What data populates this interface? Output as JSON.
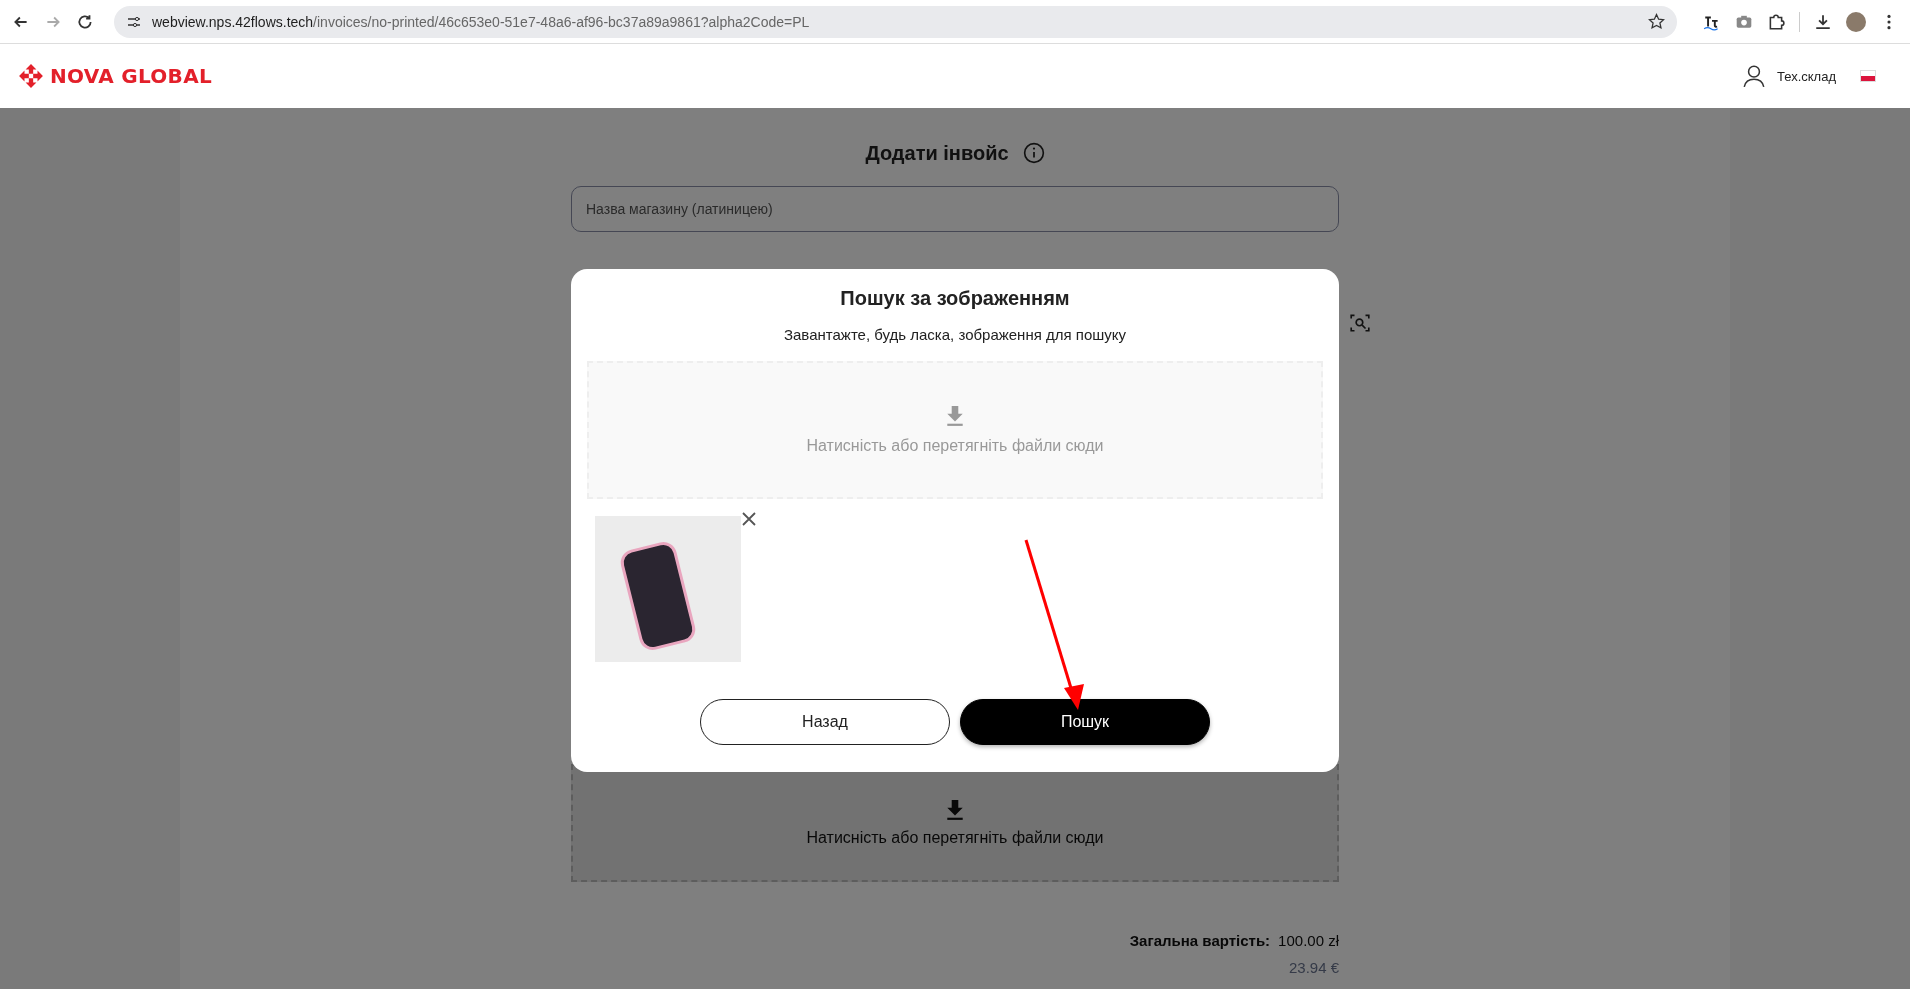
{
  "browser": {
    "url_host": "webview.nps.42flows.tech",
    "url_path": "/invoices/no-printed/46c653e0-51e7-48a6-af96-bc37a89a9861?alpha2Code=PL"
  },
  "header": {
    "brand": "NOVA GLOBAL",
    "user": "Тех.склад"
  },
  "form": {
    "title": "Додати інвойс",
    "store_field": {
      "placeholder": "Назва магазину (латиницею)"
    },
    "dropzone": {
      "text": "Натисність або перетягніть файли сюди",
      "disabled": false
    },
    "total": {
      "label": "Загальна вартість:",
      "value": "100.00 zł",
      "converted": "23.94 €"
    }
  },
  "modal": {
    "title": "Пошук за зображенням",
    "subtitle": "Завантажте, будь ласка, зображення для пошуку",
    "dropzone": {
      "text": "Натисність або перетягніть файли сюди",
      "disabled": true
    },
    "buttons": [
      {
        "label": "Назад",
        "kind": "secondary"
      },
      {
        "label": "Пошук",
        "kind": "primary"
      }
    ]
  }
}
